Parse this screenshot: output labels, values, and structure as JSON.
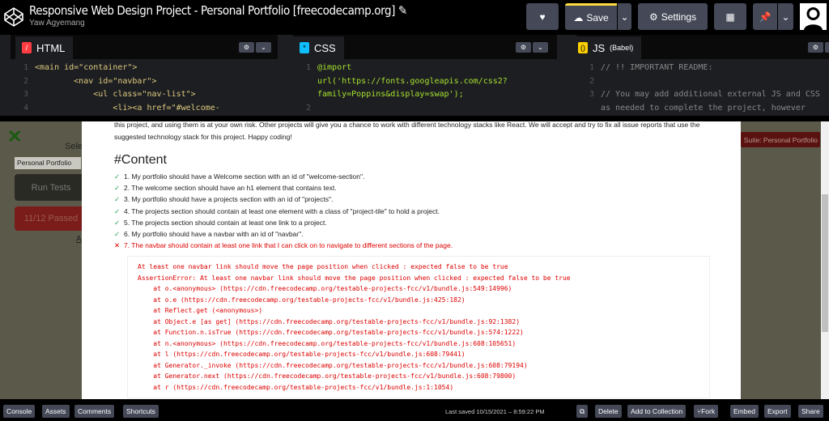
{
  "header": {
    "title": "Responsive Web Design Project - Personal Portfolio [freecodecamp.org]",
    "author": "Yaw Agyemang",
    "save": "Save",
    "settings": "Settings"
  },
  "editors": {
    "html": {
      "label": "HTML",
      "lines": [
        [
          "1",
          "<main id=\"container\">"
        ],
        [
          "2",
          "        <nav id=\"navbar\">"
        ],
        [
          "3",
          "            <ul class=\"nav-list\">"
        ],
        [
          "4",
          "                <li><a href=\"#welcome-"
        ]
      ]
    },
    "css": {
      "label": "CSS",
      "lines": [
        [
          "1",
          "@import"
        ],
        [
          "",
          "url('https://fonts.googleapis.com/css2?"
        ],
        [
          "",
          "family=Poppins&display=swap');"
        ],
        [
          "2",
          ""
        ]
      ]
    },
    "js": {
      "label": "JS",
      "sublabel": "(Babel)",
      "lines": [
        [
          "1",
          "// !! IMPORTANT README:"
        ],
        [
          "2",
          ""
        ],
        [
          "3",
          "// You may add additional external JS and CSS"
        ],
        [
          "",
          "as needed to complete the project, however"
        ]
      ]
    }
  },
  "test_panel": {
    "select_label": "Selec",
    "suite": "Personal Portfolio",
    "run": "Run Tests",
    "passed": "11/12 Passed",
    "link": "A",
    "suite_banner": "Suite: Personal Portfolio"
  },
  "modal": {
    "desc": "this project, and using them is at your own risk. Other projects will give you a chance to work with different technology stacks like React. We will accept and try to fix all issue reports that use the suggested technology stack for this project. Happy coding!",
    "heading": "#Content",
    "tests": [
      {
        "text": "1. My portfolio should have a Welcome section with an id of \"welcome-section\".",
        "pass": true
      },
      {
        "text": "2. The welcome section should have an h1 element that contains text.",
        "pass": true
      },
      {
        "text": "3. My portfolio should have a projects section with an id of \"projects\".",
        "pass": true
      },
      {
        "text": "4. The projects section should contain at least one element with a class of \"project-tile\" to hold a project.",
        "pass": true
      },
      {
        "text": "5. The projects section should contain at least one link to a project.",
        "pass": true
      },
      {
        "text": "6. My portfolio should have a navbar with an id of \"navbar\".",
        "pass": true
      },
      {
        "text": "7. The navbar should contain at least one link that I can click on to navigate to different sections of the page.",
        "pass": false
      }
    ],
    "error": [
      "At least one navbar link should move the page position when clicked : expected false to be true",
      "AssertionError: At least one navbar link should move the page position when clicked : expected false to be true",
      "    at o.<anonymous> (https://cdn.freecodecamp.org/testable-projects-fcc/v1/bundle.js:549:14996)",
      "    at o.e (https://cdn.freecodecamp.org/testable-projects-fcc/v1/bundle.js:425:182)",
      "    at Reflect.get (<anonymous>)",
      "    at Object.e [as get] (https://cdn.freecodecamp.org/testable-projects-fcc/v1/bundle.js:92:1382)",
      "    at Function.n.isTrue (https://cdn.freecodecamp.org/testable-projects-fcc/v1/bundle.js:574:1222)",
      "    at n.<anonymous> (https://cdn.freecodecamp.org/testable-projects-fcc/v1/bundle.js:608:105651)",
      "    at l (https://cdn.freecodecamp.org/testable-projects-fcc/v1/bundle.js:608:79441)",
      "    at Generator._invoke (https://cdn.freecodecamp.org/testable-projects-fcc/v1/bundle.js:608:79194)",
      "    at Generator.next (https://cdn.freecodecamp.org/testable-projects-fcc/v1/bundle.js:608:79800)",
      "    at r (https://cdn.freecodecamp.org/testable-projects-fcc/v1/bundle.js:1:1054)"
    ]
  },
  "footer": {
    "left": [
      "Console",
      "Assets",
      "Comments",
      "Shortcuts"
    ],
    "saved": "Last saved 10/15/2021 – 8:59:22 PM",
    "right": [
      "Delete",
      "Add to Collection",
      "Fork",
      "Embed",
      "Export",
      "Share"
    ]
  },
  "colors": {
    "pass": "#2a9d56",
    "fail": "#dd0000",
    "button": "#444857",
    "html": "#ff3c41",
    "css": "#0ebeff",
    "js": "#fcd000"
  }
}
